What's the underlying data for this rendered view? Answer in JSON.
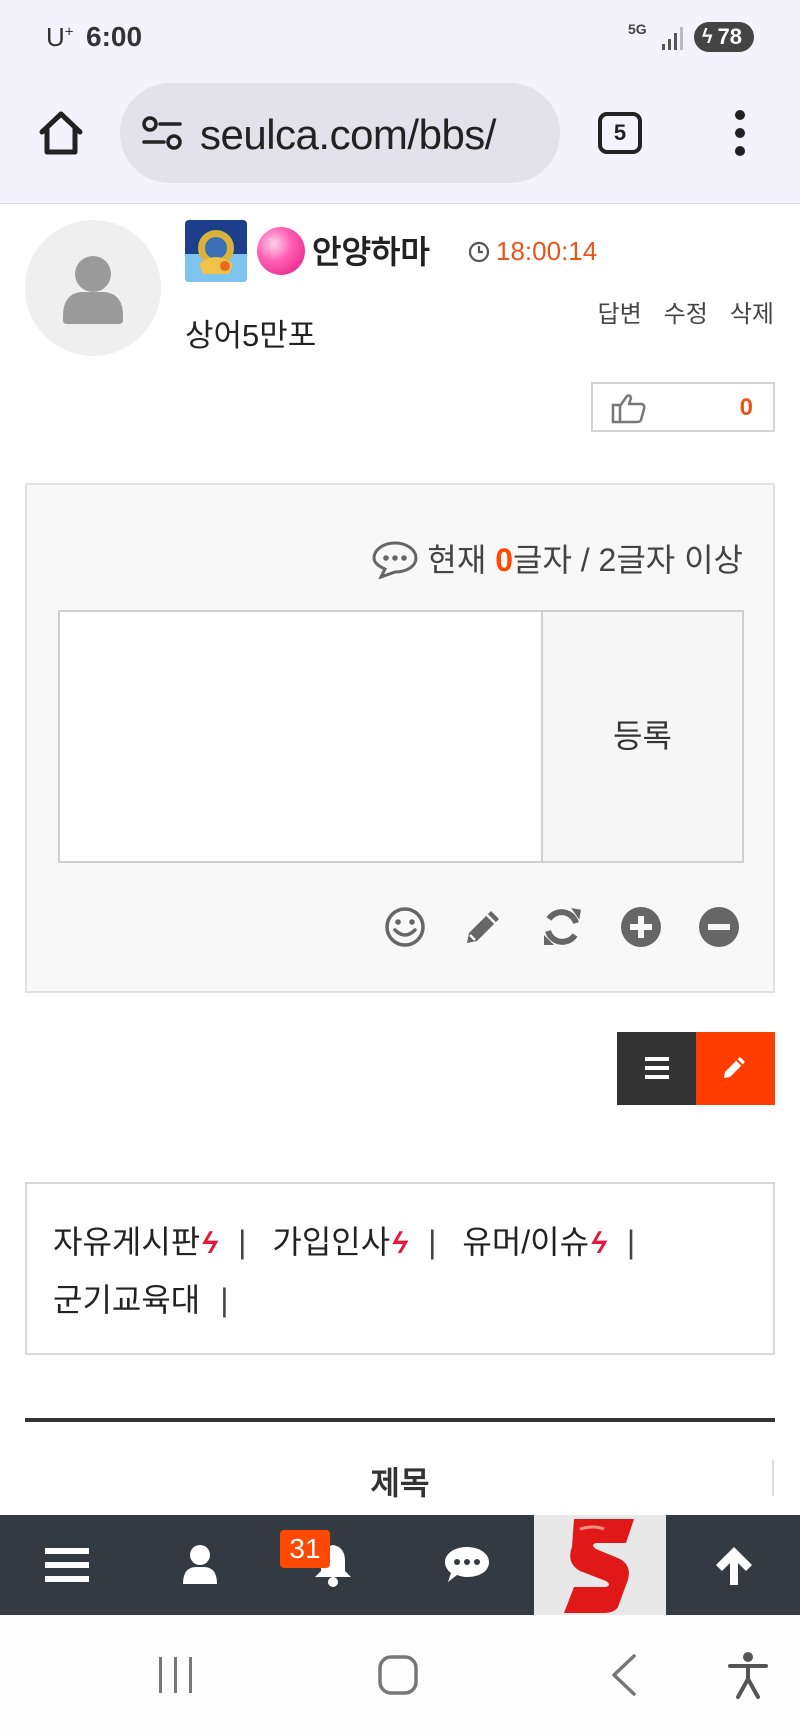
{
  "status_bar": {
    "carrier": "U",
    "carrier_sup": "+",
    "time": "6:00",
    "network": "5G",
    "battery": "78"
  },
  "browser": {
    "url": "seulca.com/bbs/",
    "tab_count": "5"
  },
  "comment": {
    "author": "안양하마",
    "time": "18:00:14",
    "text": "상어5만포",
    "actions": {
      "reply": "답변",
      "edit": "수정",
      "delete": "삭제"
    },
    "like_count": "0"
  },
  "write_panel": {
    "count_prefix": "현재 ",
    "count_value": "0",
    "count_suffix": "글자 / 2글자 이상",
    "textarea_value": "",
    "submit_label": "등록",
    "tools": [
      "emoji-icon",
      "pencil-icon",
      "refresh-icon",
      "plus-circle-icon",
      "minus-circle-icon"
    ]
  },
  "boards": {
    "items": [
      {
        "label": "자유게시판",
        "hot": true
      },
      {
        "label": "가입인사",
        "hot": true
      },
      {
        "label": "유머/이슈",
        "hot": true
      },
      {
        "label": "군기교육대",
        "hot": false
      }
    ],
    "hot_glyph": "ϟ",
    "separator": "|"
  },
  "list_header": {
    "title_column": "제목"
  },
  "bottom_nav": {
    "notification_badge": "31",
    "items": [
      "menu-icon",
      "user-icon",
      "bell-icon",
      "chat-icon",
      "site-logo",
      "arrow-up-icon"
    ]
  },
  "colors": {
    "accent": "#ff4800",
    "time": "#e8541c",
    "nav_bg": "#333a42",
    "hot": "#e8163c"
  }
}
